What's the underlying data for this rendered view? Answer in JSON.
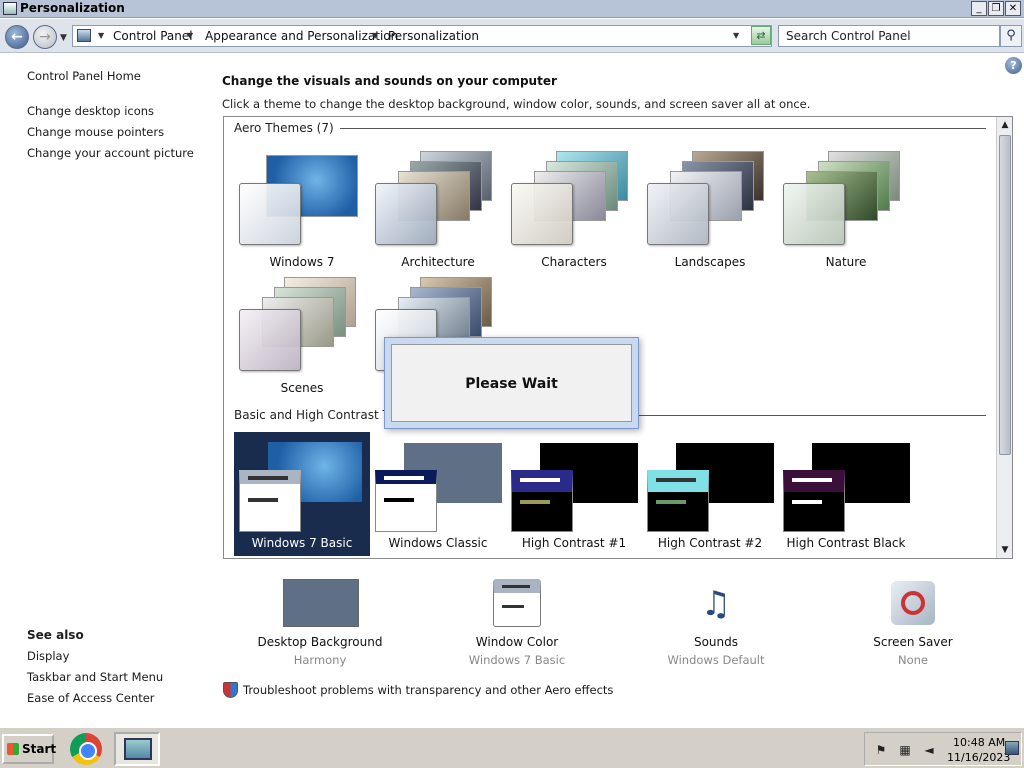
{
  "window": {
    "title": "Personalization"
  },
  "address": {
    "crumbs": [
      "Control Panel",
      "Appearance and Personalization",
      "Personalization"
    ],
    "search_placeholder": "Search Control Panel"
  },
  "left_nav": {
    "items": [
      "Control Panel Home",
      "Change desktop icons",
      "Change mouse pointers",
      "Change your account picture"
    ],
    "see_also_title": "See also",
    "see_also": [
      "Display",
      "Taskbar and Start Menu",
      "Ease of Access Center"
    ]
  },
  "main": {
    "heading": "Change the visuals and sounds on your computer",
    "subheading": "Click a theme to change the desktop background, window color, sounds, and screen saver all at once."
  },
  "theme_groups": {
    "aero_label": "Aero Themes (7)",
    "aero_themes": [
      "Windows 7",
      "Architecture",
      "Characters",
      "Landscapes",
      "Nature",
      "Scenes"
    ],
    "basic_label": "Basic and High Contrast Themes",
    "basic_themes": [
      "Windows 7 Basic",
      "Windows Classic",
      "High Contrast #1",
      "High Contrast #2",
      "High Contrast Black"
    ],
    "selected": "Windows 7 Basic"
  },
  "dialog": {
    "message": "Please Wait"
  },
  "options": [
    {
      "label": "Desktop Background",
      "value": "Harmony"
    },
    {
      "label": "Window Color",
      "value": "Windows 7 Basic"
    },
    {
      "label": "Sounds",
      "value": "Windows Default"
    },
    {
      "label": "Screen Saver",
      "value": "None"
    }
  ],
  "troubleshoot_link": "Troubleshoot problems with transparency and other Aero effects",
  "taskbar": {
    "start_label": "Start",
    "clock_time": "10:48 AM",
    "clock_date": "11/16/2023"
  },
  "colors": {
    "selected_theme_bg": "#1a2c4d",
    "desktop_background_swatch": "#5f6f86",
    "hc1_accent": "#2a2a8a",
    "hc2_accent": "#7fe0e6",
    "hcblack_accent": "#3a0f3a"
  },
  "icons": [
    "back-arrow-icon",
    "forward-arrow-icon",
    "control-panel-icon",
    "refresh-icon",
    "search-icon",
    "help-icon",
    "shield-icon",
    "sounds-icon",
    "screen-saver-icon",
    "chrome-icon",
    "speaker-icon",
    "network-icon",
    "flag-icon"
  ]
}
